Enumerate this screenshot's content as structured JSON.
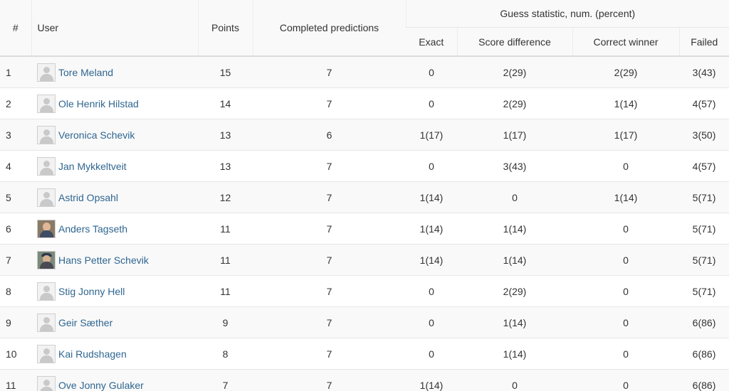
{
  "headers": {
    "rank": "#",
    "user": "User",
    "points": "Points",
    "completed": "Completed predictions",
    "guess_group": "Guess statistic, num. (percent)",
    "exact": "Exact",
    "score_difference": "Score difference",
    "correct_winner": "Correct winner",
    "failed": "Failed"
  },
  "rows": [
    {
      "rank": "1",
      "name": "Tore Meland",
      "avatar": "default-avatar-icon",
      "points": "15",
      "completed": "7",
      "exact": "0",
      "score_difference": "2(29)",
      "correct_winner": "2(29)",
      "failed": "3(43)"
    },
    {
      "rank": "2",
      "name": "Ole Henrik Hilstad",
      "avatar": "default-avatar-icon",
      "points": "14",
      "completed": "7",
      "exact": "0",
      "score_difference": "2(29)",
      "correct_winner": "1(14)",
      "failed": "4(57)"
    },
    {
      "rank": "3",
      "name": "Veronica Schevik",
      "avatar": "default-avatar-icon",
      "points": "13",
      "completed": "6",
      "exact": "1(17)",
      "score_difference": "1(17)",
      "correct_winner": "1(17)",
      "failed": "3(50)"
    },
    {
      "rank": "4",
      "name": "Jan Mykkeltveit",
      "avatar": "default-avatar-icon",
      "points": "13",
      "completed": "7",
      "exact": "0",
      "score_difference": "3(43)",
      "correct_winner": "0",
      "failed": "4(57)"
    },
    {
      "rank": "5",
      "name": "Astrid Opsahl",
      "avatar": "default-avatar-icon",
      "points": "12",
      "completed": "7",
      "exact": "1(14)",
      "score_difference": "0",
      "correct_winner": "1(14)",
      "failed": "5(71)"
    },
    {
      "rank": "6",
      "name": "Anders Tagseth",
      "avatar": "photo-avatar",
      "points": "11",
      "completed": "7",
      "exact": "1(14)",
      "score_difference": "1(14)",
      "correct_winner": "0",
      "failed": "5(71)"
    },
    {
      "rank": "7",
      "name": "Hans Petter Schevik",
      "avatar": "photo-avatar",
      "points": "11",
      "completed": "7",
      "exact": "1(14)",
      "score_difference": "1(14)",
      "correct_winner": "0",
      "failed": "5(71)"
    },
    {
      "rank": "8",
      "name": "Stig Jonny Hell",
      "avatar": "default-avatar-icon",
      "points": "11",
      "completed": "7",
      "exact": "0",
      "score_difference": "2(29)",
      "correct_winner": "0",
      "failed": "5(71)"
    },
    {
      "rank": "9",
      "name": "Geir Sæther",
      "avatar": "default-avatar-icon",
      "points": "9",
      "completed": "7",
      "exact": "0",
      "score_difference": "1(14)",
      "correct_winner": "0",
      "failed": "6(86)"
    },
    {
      "rank": "10",
      "name": "Kai Rudshagen",
      "avatar": "default-avatar-icon",
      "points": "8",
      "completed": "7",
      "exact": "0",
      "score_difference": "1(14)",
      "correct_winner": "0",
      "failed": "6(86)"
    },
    {
      "rank": "11",
      "name": "Ove Jonny Gulaker",
      "avatar": "default-avatar-icon",
      "points": "7",
      "completed": "7",
      "exact": "1(14)",
      "score_difference": "0",
      "correct_winner": "0",
      "failed": "6(86)"
    }
  ],
  "colors": {
    "link": "#2f6690",
    "stripe": "#f9f9f9",
    "border": "#e6e6e6"
  }
}
